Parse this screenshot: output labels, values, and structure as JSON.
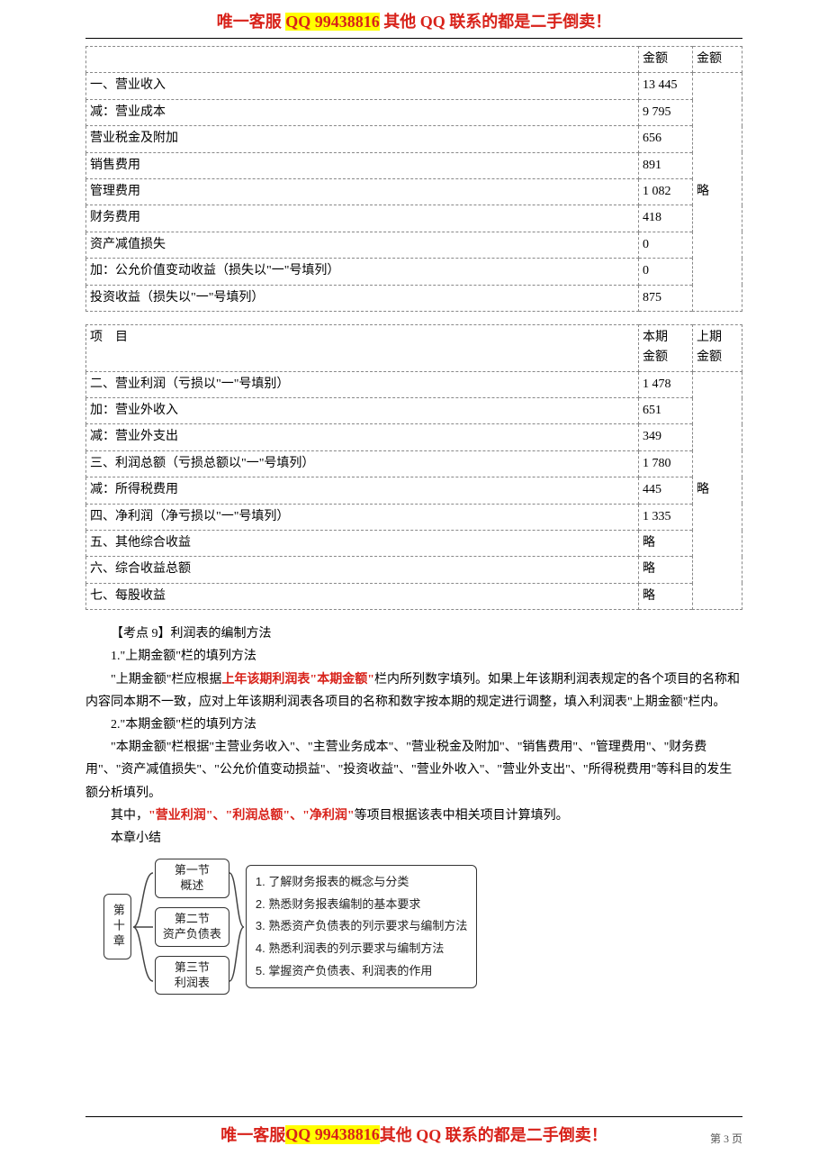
{
  "banner": {
    "p1": "唯一客服 ",
    "p2_hl": "QQ 99438816",
    "p3": "  其他 QQ 联系的都是二手倒卖！"
  },
  "page_number": "第 3 页",
  "table1": {
    "headers": {
      "c2": "金额",
      "c3": "金额"
    },
    "rows0": [
      {
        "label": "一、营业收入",
        "amt": "13  445"
      },
      {
        "label": "减：营业成本",
        "amt": "9  795"
      },
      {
        "label": "营业税金及附加",
        "amt": "656"
      },
      {
        "label": "销售费用",
        "amt": "891"
      },
      {
        "label": "管理费用",
        "amt": "1  082"
      },
      {
        "label": "财务费用",
        "amt": "418"
      },
      {
        "label": "资产减值损失",
        "amt": "0"
      },
      {
        "label": "加：公允价值变动收益（损失以\"一\"号填列）",
        "amt": "0"
      },
      {
        "label": "投资收益（损失以\"一\"号填列）",
        "amt": "875"
      }
    ],
    "merged_right": "略"
  },
  "table2": {
    "headers": {
      "c1": "项　目",
      "c2a": "本期",
      "c2b": "金额",
      "c3a": "上期",
      "c3b": "金额"
    },
    "rows0": [
      {
        "label": "二、营业利润（亏损以\"一\"号填别）",
        "amt": "1  478"
      },
      {
        "label": "加：营业外收入",
        "amt": "651"
      },
      {
        "label": "减：营业外支出",
        "amt": "349"
      },
      {
        "label": "三、利润总额（亏损总额以\"一\"号填列）",
        "amt": "1  780"
      },
      {
        "label": "减：所得税费用",
        "amt": "445"
      },
      {
        "label": "四、净利润（净亏损以\"一\"号填列）",
        "amt": "1  335"
      },
      {
        "label": "五、其他综合收益",
        "amt": "略"
      },
      {
        "label": "六、综合收益总额",
        "amt": "略"
      },
      {
        "label": "七、每股收益",
        "amt": "略"
      }
    ],
    "merged_right": "略"
  },
  "body": {
    "l1": "【考点 9】利润表的编制方法",
    "l2": "1.\"上期金额\"栏的填列方法",
    "l3a": "\"上期金额\"栏应根据",
    "l3b_red": "上年该期利润表\"本期金额\"",
    "l3c": "栏内所列数字填列。如果上年该期利润表规定的各个项目的名称和内容同本期不一致，应对上年该期利润表各项目的名称和数字按本期的规定进行调整，填入利润表\"上期金额\"栏内。",
    "l4": "2.\"本期金额\"栏的填列方法",
    "l5": "\"本期金额\"栏根据\"主营业务收入\"、\"主营业务成本\"、\"营业税金及附加\"、\"销售费用\"、\"管理费用\"、\"财务费用\"、\"资产减值损失\"、\"公允价值变动损益\"、\"投资收益\"、\"营业外收入\"、\"营业外支出\"、\"所得税费用\"等科目的发生额分析填列。",
    "l6a": "其中，",
    "l6b_red": "\"营业利润\"、\"利润总额\"、\"净利润\"",
    "l6c": "等项目根据该表中相关项目计算填列。",
    "l7": "本章小结"
  },
  "diagram": {
    "chapter": "第十章",
    "sections": [
      {
        "t1": "第一节",
        "t2": "概述"
      },
      {
        "t1": "第二节",
        "t2": "资产负债表"
      },
      {
        "t1": "第三节",
        "t2": "利润表"
      }
    ],
    "points": [
      "1. 了解财务报表的概念与分类",
      "2. 熟悉财务报表编制的基本要求",
      "3. 熟悉资产负债表的列示要求与编制方法",
      "4. 熟悉利润表的列示要求与编制方法",
      "5. 掌握资产负债表、利润表的作用"
    ]
  }
}
